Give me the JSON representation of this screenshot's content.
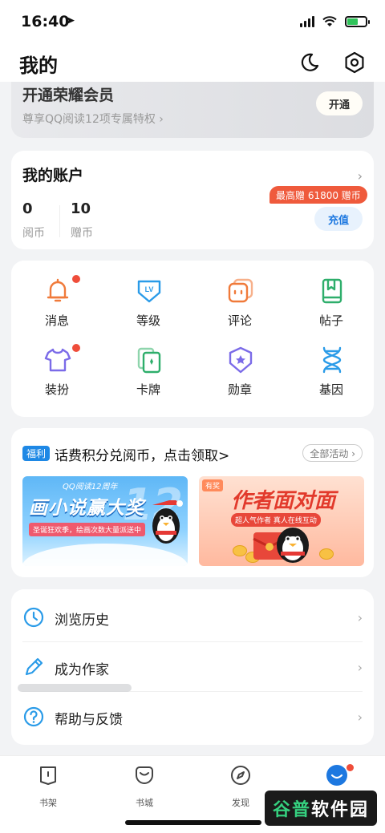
{
  "status_bar": {
    "time": "16:40"
  },
  "header": {
    "title": "我的"
  },
  "vip": {
    "title": "开通荣耀会员",
    "subtitle": "尊享QQ阅读12项专属特权 ›",
    "button": "开通"
  },
  "account": {
    "title": "我的账户",
    "coins_value": "0",
    "coins_label": "阅币",
    "gift_value": "10",
    "gift_label": "赠币",
    "promo_badge": "最高赠 61800 赠币",
    "recharge_button": "充值"
  },
  "features": [
    {
      "label": "消息",
      "icon": "bell-icon",
      "badge": true,
      "color": "#f07a3a"
    },
    {
      "label": "等级",
      "icon": "level-icon",
      "badge": false,
      "color": "#2a9be8"
    },
    {
      "label": "评论",
      "icon": "comment-icon",
      "badge": false,
      "color": "#f07a3a"
    },
    {
      "label": "帖子",
      "icon": "bookmark-icon",
      "badge": false,
      "color": "#2eae6b"
    },
    {
      "label": "装扮",
      "icon": "shirt-icon",
      "badge": true,
      "color": "#7b6be8"
    },
    {
      "label": "卡牌",
      "icon": "card-icon",
      "badge": false,
      "color": "#2eae6b"
    },
    {
      "label": "勋章",
      "icon": "medal-icon",
      "badge": false,
      "color": "#7b6be8"
    },
    {
      "label": "基因",
      "icon": "dna-icon",
      "badge": false,
      "color": "#2a9be8"
    }
  ],
  "events": {
    "tag": "福利",
    "title": "话费积分兑阅币，点击领取>",
    "all_button": "全部活动 ›",
    "banner1": {
      "top": "QQ阅读12周年",
      "main": "画小说赢大奖",
      "sub": "圣诞狂欢季，绘画次数大量派送中",
      "num": "12"
    },
    "banner2": {
      "tag": "有奖",
      "main": "作者面对面",
      "sub": "超人气作者 真人在线互动"
    }
  },
  "menu": [
    {
      "label": "浏览历史",
      "icon": "clock-icon"
    },
    {
      "label": "成为作家",
      "icon": "pen-icon"
    },
    {
      "label": "帮助与反馈",
      "icon": "help-icon"
    }
  ],
  "tabs": [
    {
      "label": "书架",
      "icon": "bookshelf-icon"
    },
    {
      "label": "书城",
      "icon": "store-icon"
    },
    {
      "label": "发现",
      "icon": "compass-icon"
    },
    {
      "label": "我的",
      "icon": "me-icon"
    }
  ],
  "watermark": {
    "text_g": "谷普",
    "text_w": "软件园"
  },
  "colors": {
    "accent": "#1d78e0",
    "badge_red": "#ef4d3a",
    "promo": "#ef5a3c"
  }
}
